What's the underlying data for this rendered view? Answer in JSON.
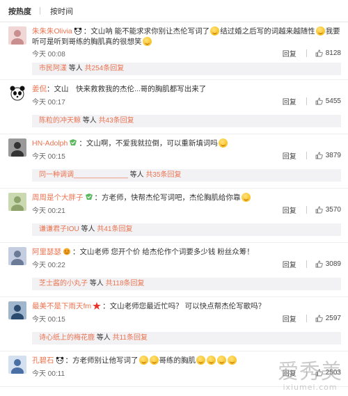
{
  "sort_tabs": [
    {
      "label": "按热度",
      "active": true
    },
    {
      "label": "按时间",
      "active": false
    }
  ],
  "comments": [
    {
      "author": "朱朱朱Olivia",
      "badge": "panda",
      "text_parts": [
        "：文山呐 能不能求求你别让杰伦写词了",
        "结过婚之后写的词越来越随性",
        "我要听可是听到哥练的胸肌真的很想笑"
      ],
      "time": "今天 00:08",
      "reply_label": "回复",
      "likes": "8128",
      "sub_user": "市民阿漾",
      "sub_mid": " 等人 ",
      "sub_more": "共254条回复"
    },
    {
      "author": "姜侃",
      "badge": "",
      "text_parts": [
        "：文山　快来救救我的杰伦...哥的胸肌都写出来了"
      ],
      "time": "今天 00:17",
      "reply_label": "回复",
      "likes": "5455",
      "sub_user": "陈粒的冲天鲸",
      "sub_mid": " 等人 ",
      "sub_more": "共43条回复"
    },
    {
      "author": "HN-Adolph",
      "badge": "green",
      "text_parts": [
        "：文山啊，不爱我就拉倒，可以重新填词吗"
      ],
      "time": "今天 00:15",
      "reply_label": "回复",
      "likes": "3879",
      "sub_user": "同一种调调______________",
      "sub_mid": " 等人 ",
      "sub_more": "共35条回复"
    },
    {
      "author": "周周是个大胖子",
      "badge": "green",
      "text_parts": [
        "：方老师，快帮杰伦写词吧，杰伦胸肌给你靠"
      ],
      "time": "今天 00:21",
      "reply_label": "回复",
      "likes": "3570",
      "sub_user": "谦谦君子IOU",
      "sub_mid": " 等人 ",
      "sub_more": "共41条回复"
    },
    {
      "author": "阿里瑟瑟",
      "badge": "emoji",
      "text_parts": [
        "：文山老师 您开个价 给杰伦作个词要多少钱 粉丝众筹！"
      ],
      "time": "今天 00:22",
      "reply_label": "回复",
      "likes": "3089",
      "sub_user": "芝士酱的小丸子",
      "sub_mid": " 等人 ",
      "sub_more": "共118条回复"
    },
    {
      "author": "最美不是下雨天fm",
      "badge": "star",
      "text_parts": [
        "：文山老师您最近忙吗？ 可以快点帮杰伦写歌吗？"
      ],
      "time": "今天 00:15",
      "reply_label": "回复",
      "likes": "2597",
      "sub_user": "诗心纸上的梅花鹿",
      "sub_mid": " 等人 ",
      "sub_more": "共11条回复"
    },
    {
      "author": "孔碧石",
      "badge": "panda",
      "text_parts": [
        "：方老师别让他写词了",
        "哥练的胸肌"
      ],
      "time": "今天 00:11",
      "reply_label": "回复",
      "likes": "2503",
      "sub_user": "",
      "sub_mid": "",
      "sub_more": ""
    }
  ],
  "watermark": {
    "big": "爱秀美",
    "small": "ixiumei.com"
  },
  "colors": {
    "author": "#eb7350",
    "sub_bg": "#f2f2f5"
  }
}
